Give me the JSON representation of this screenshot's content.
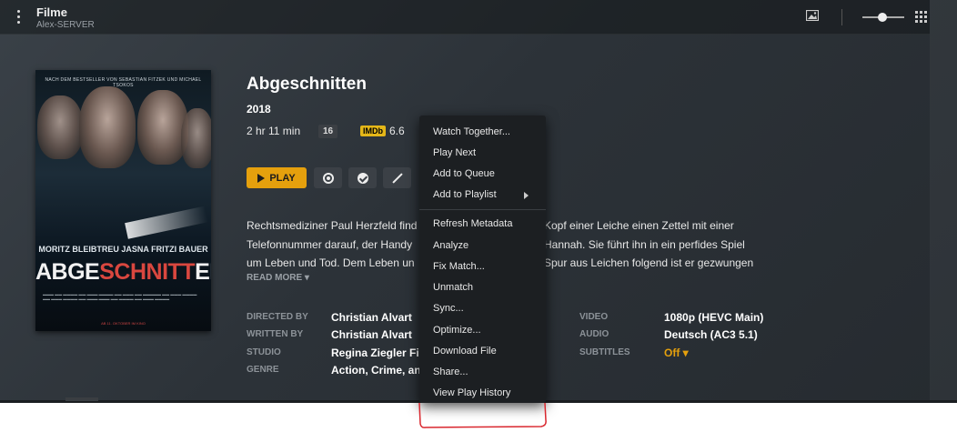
{
  "header": {
    "title": "Filme",
    "server": "Alex-SERVER"
  },
  "poster": {
    "top_text": "NACH DEM BESTSELLER VON SEBASTIAN FITZEK UND MICHAEL TSOKOS",
    "names": "MORITZ BLEIBTREU  JASNA FRITZI BAUER",
    "logo_a": "ABGE",
    "logo_b": "SCHNITT",
    "logo_c": "EN",
    "date": "AB 11. OKTOBER IM KINO"
  },
  "movie": {
    "title": "Abgeschnitten",
    "year": "2018",
    "duration": "2 hr 11 min",
    "content_rating": "16",
    "imdb_label": "IMDb",
    "imdb_score": "6.6",
    "play_label": "PLAY",
    "summary_lines": [
      "Rechtsmediziner Paul Herzfeld find",
      "Kopf einer Leiche einen Zettel mit einer",
      "Telefonnummer darauf, der Handy",
      "Hannah. Sie führt ihn in ein perfides Spiel",
      "um Leben und Tod. Dem Leben un",
      "Spur aus Leichen folgend ist er gezwungen"
    ],
    "read_more": "READ MORE ▾"
  },
  "details": {
    "directed_by_label": "DIRECTED BY",
    "directed_by": "Christian Alvart",
    "written_by_label": "WRITTEN BY",
    "written_by": "Christian Alvart",
    "studio_label": "STUDIO",
    "studio": "Regina Ziegler Film",
    "genre_label": "GENRE",
    "genre": "Action, Crime, and",
    "video_label": "VIDEO",
    "video": "1080p (HEVC Main)",
    "audio_label": "AUDIO",
    "audio": "Deutsch (AC3 5.1)",
    "subtitles_label": "SUBTITLES",
    "subtitles": "Off ▾"
  },
  "context_menu": {
    "items": [
      "Watch Together...",
      "Play Next",
      "Add to Queue",
      "Add to Playlist",
      "Refresh Metadata",
      "Analyze",
      "Fix Match...",
      "Unmatch",
      "Sync...",
      "Optimize...",
      "Download File",
      "Share...",
      "View Play History"
    ]
  },
  "colors": {
    "accent": "#e5a00d",
    "imdb": "#e5b718",
    "annotation": "#d9272e"
  }
}
